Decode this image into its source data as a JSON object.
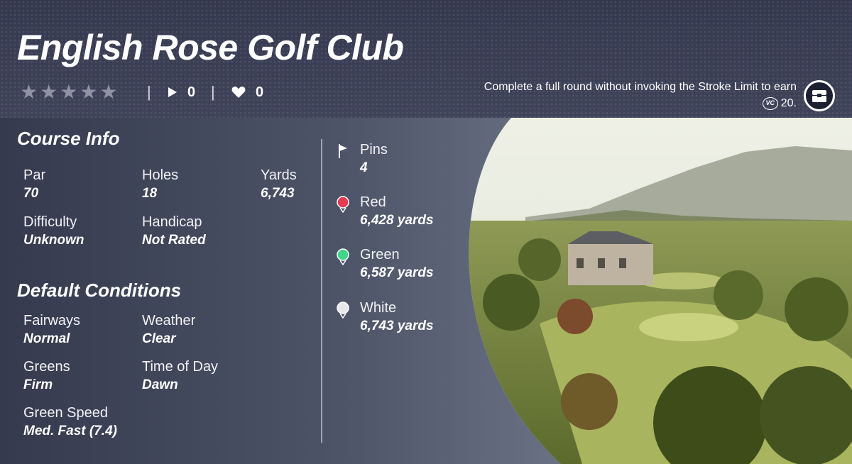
{
  "course": {
    "name": "English Rose Golf Club",
    "rating_stars": 0,
    "plays": "0",
    "likes": "0"
  },
  "challenge": {
    "text": "Complete a full round without invoking the Stroke Limit to earn",
    "reward_icon": "vc-coin-icon",
    "reward_amount": "20."
  },
  "course_info": {
    "heading": "Course Info",
    "par": {
      "label": "Par",
      "value": "70"
    },
    "holes": {
      "label": "Holes",
      "value": "18"
    },
    "yards": {
      "label": "Yards",
      "value": "6,743"
    },
    "difficulty": {
      "label": "Difficulty",
      "value": "Unknown"
    },
    "handicap": {
      "label": "Handicap",
      "value": "Not Rated"
    }
  },
  "default_conditions": {
    "heading": "Default Conditions",
    "fairways": {
      "label": "Fairways",
      "value": "Normal"
    },
    "weather": {
      "label": "Weather",
      "value": "Clear"
    },
    "greens": {
      "label": "Greens",
      "value": "Firm"
    },
    "time_of_day": {
      "label": "Time of Day",
      "value": "Dawn"
    },
    "green_speed": {
      "label": "Green Speed",
      "value": "Med. Fast (7.4)"
    }
  },
  "pins": {
    "label": "Pins",
    "value": "4"
  },
  "tees": [
    {
      "label": "Red",
      "value": "6,428 yards",
      "color": "#e8394f"
    },
    {
      "label": "Green",
      "value": "6,587 yards",
      "color": "#3fd68a"
    },
    {
      "label": "White",
      "value": "6,743 yards",
      "color": "#e8e8ec"
    }
  ],
  "colors": {
    "header_bg": "#3b3f55",
    "star_empty": "#8f93a3"
  }
}
